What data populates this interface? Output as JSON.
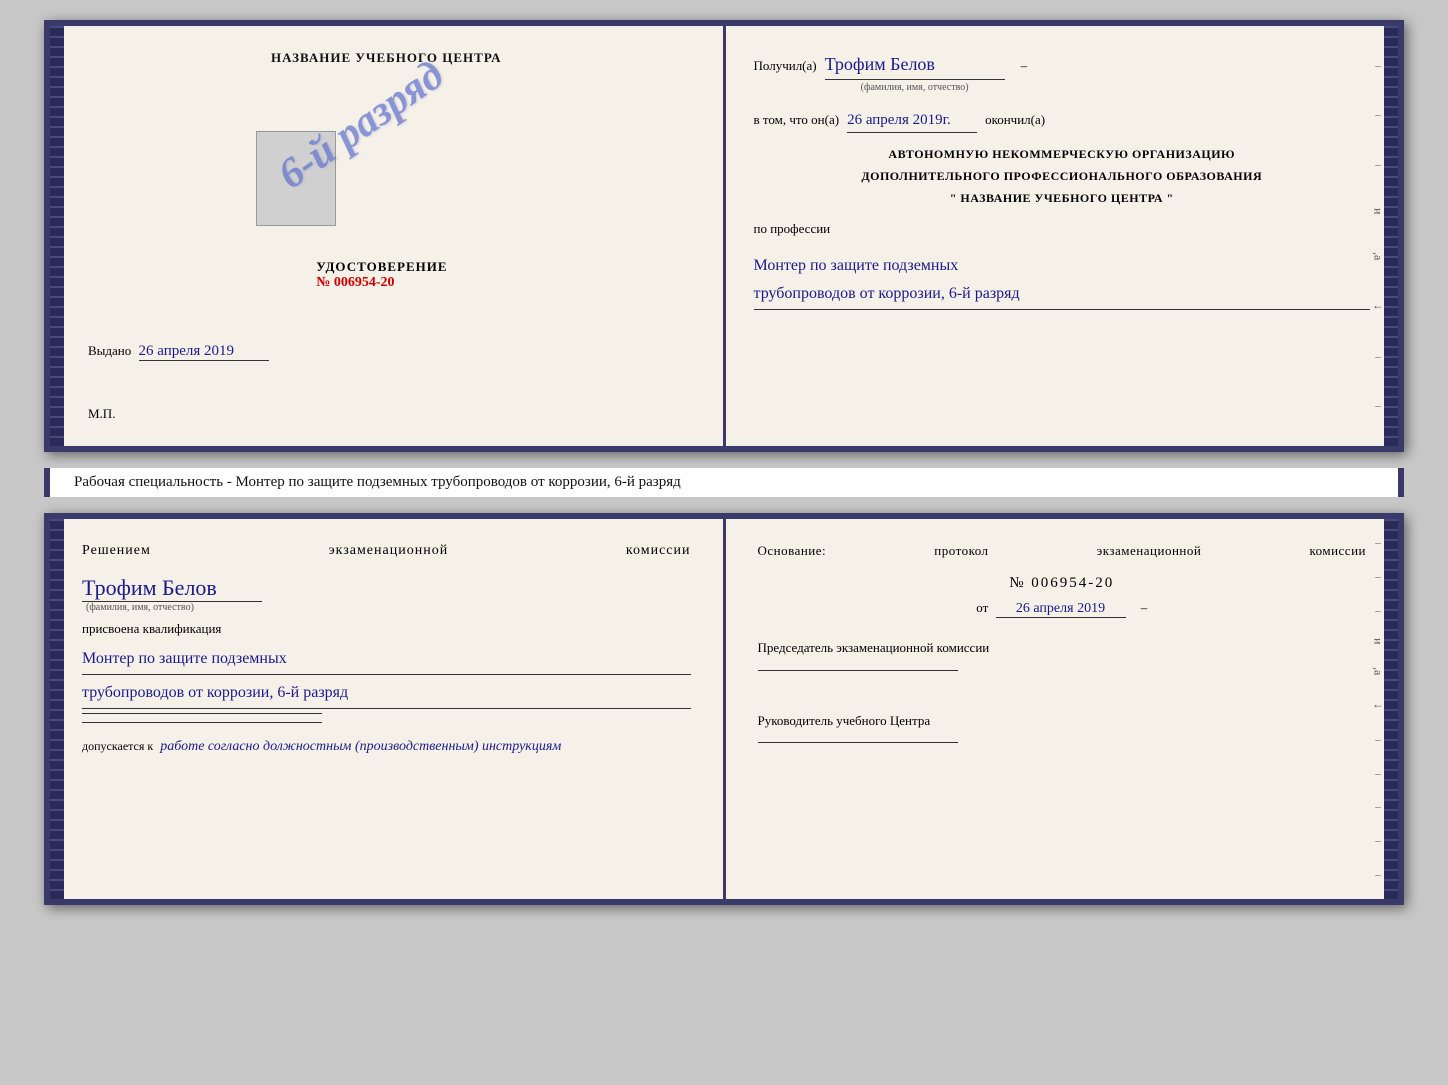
{
  "top": {
    "left": {
      "title": "НАЗВАНИЕ УЧЕБНОГО ЦЕНТРА",
      "stamp_text": "6-й разряд",
      "udostoverenie_label": "УДОСТОВЕРЕНИЕ",
      "udostoverenie_number": "№ 006954-20",
      "vydano_label": "Выдано",
      "vydano_date": "26 апреля 2019",
      "mp_label": "М.П."
    },
    "right": {
      "poluchil_label": "Получил(a)",
      "poluchil_name": "Трофим Белов",
      "poluchil_hint": "(фамилия, имя, отчество)",
      "dash1": "–",
      "vtom_label": "в том, что он(а)",
      "vtom_date": "26 апреля 2019г.",
      "okonchil_label": "окончил(а)",
      "org_line1": "АВТОНОМНУЮ НЕКОММЕРЧЕСКУЮ ОРГАНИЗАЦИЮ",
      "org_line2": "ДОПОЛНИТЕЛЬНОГО ПРОФЕССИОНАЛЬНОГО ОБРАЗОВАНИЯ",
      "org_line3": "\"   НАЗВАНИЕ УЧЕБНОГО ЦЕНТРА   \"",
      "po_professii": "по профессии",
      "profession_line1": "Монтер по защите подземных",
      "profession_line2": "трубопроводов от коррозии, 6-й разряд"
    }
  },
  "specialty_label": "Рабочая специальность - Монтер по защите подземных трубопроводов от коррозии, 6-й разряд",
  "bottom": {
    "left": {
      "resheniem": "Решением  экзаменационной  комиссии",
      "name": "Трофим Белов",
      "name_hint": "(фамилия, имя, отчество)",
      "prisvoena": "присвоена квалификация",
      "profession_line1": "Монтер по защите подземных",
      "profession_line2": "трубопроводов от коррозии, 6-й разряд",
      "dopuskaetsya": "допускается к",
      "dopusk_italic": "работе согласно должностным (производственным) инструкциям"
    },
    "right": {
      "osnovanie": "Основание:  протокол  экзаменационной  комиссии",
      "number": "№  006954-20",
      "ot_label": "от",
      "ot_date": "26 апреля 2019",
      "predsedatel_title": "Председатель экзаменационной комиссии",
      "rukovoditel_title": "Руководитель учебного Центра"
    },
    "side": {
      "chars": [
        "–",
        "–",
        "–",
        "и",
        ",а",
        "←",
        "–",
        "–",
        "–",
        "–",
        "–"
      ]
    }
  }
}
